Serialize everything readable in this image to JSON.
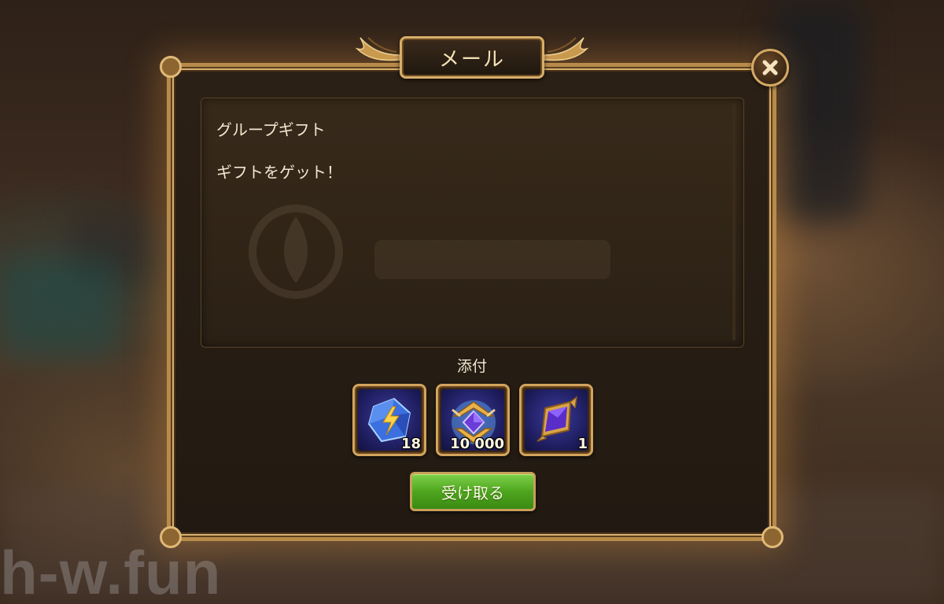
{
  "dialog": {
    "title": "メール",
    "close_icon": "close-x-icon"
  },
  "message": {
    "subject": "グループギフト",
    "body": "ギフトをゲット！"
  },
  "attachments": {
    "label": "添付",
    "items": [
      {
        "icon": "energy-crystal-icon",
        "quantity": "18"
      },
      {
        "icon": "winged-gem-emblem-icon",
        "quantity": "10 000"
      },
      {
        "icon": "purple-rune-shard-icon",
        "quantity": "1"
      }
    ]
  },
  "actions": {
    "claim_label": "受け取る"
  },
  "watermark": "h-w.fun",
  "colors": {
    "frame_gold": "#d2a45c",
    "text_cream": "#f2e6cf",
    "button_green": "#4ea61f",
    "panel_dark": "#221a12"
  }
}
